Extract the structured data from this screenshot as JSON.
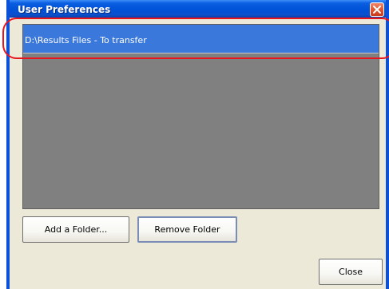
{
  "window": {
    "title": "User Preferences",
    "close_icon": "close-icon"
  },
  "folders": {
    "items": [
      {
        "path": "D:\\Results Files - To transfer",
        "selected": true
      }
    ]
  },
  "buttons": {
    "add_folder": "Add a Folder...",
    "remove_folder": "Remove Folder",
    "close": "Close"
  },
  "colors": {
    "titlebar": "#0052d8",
    "selection": "#3a78dc",
    "list_background": "#808080",
    "annotation": "#e8141e"
  }
}
